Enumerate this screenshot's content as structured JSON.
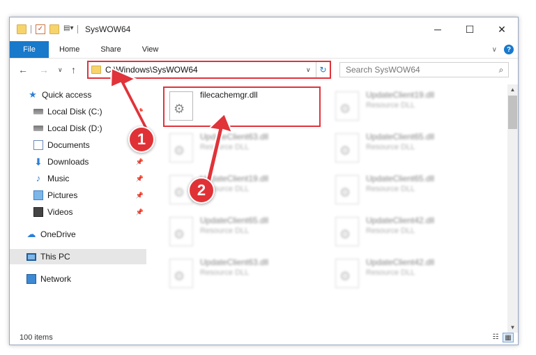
{
  "window": {
    "title": "SysWOW64",
    "minimize": "─",
    "maximize": "☐",
    "close": "✕"
  },
  "ribbon": {
    "file": "File",
    "tabs": [
      "Home",
      "Share",
      "View"
    ],
    "expand": "∨",
    "help": "?"
  },
  "address": {
    "path": "C:\\Windows\\SysWOW64",
    "dropdown": "∨",
    "refresh": "↻"
  },
  "search": {
    "placeholder": "Search SysWOW64",
    "icon": "⌕"
  },
  "nav_buttons": {
    "back": "←",
    "forward": "→",
    "recent": "∨",
    "up": "↑"
  },
  "sidebar": {
    "items": [
      {
        "label": "Quick access",
        "icon": "star-icon"
      },
      {
        "label": "Local Disk (C:)",
        "icon": "disk-icon",
        "pinned": true
      },
      {
        "label": "Local Disk (D:)",
        "icon": "disk-icon"
      },
      {
        "label": "Documents",
        "icon": "documents-icon",
        "pinned": true
      },
      {
        "label": "Downloads",
        "icon": "download-icon",
        "pinned": true
      },
      {
        "label": "Music",
        "icon": "music-icon",
        "pinned": true
      },
      {
        "label": "Pictures",
        "icon": "pictures-icon",
        "pinned": true
      },
      {
        "label": "Videos",
        "icon": "videos-icon",
        "pinned": true
      },
      {
        "label": "OneDrive",
        "icon": "cloud-icon"
      },
      {
        "label": "This PC",
        "icon": "computer-icon",
        "selected": true
      },
      {
        "label": "Network",
        "icon": "network-icon"
      }
    ]
  },
  "files": [
    {
      "name": "filecachemgr.dll",
      "type": ""
    },
    {
      "name": "UpdateClient19.dll",
      "type": "Resource DLL"
    },
    {
      "name": "UpdateClient63.dll",
      "type": "Resource DLL"
    },
    {
      "name": "UpdateClient65.dll",
      "type": "Resource DLL"
    },
    {
      "name": "UpdateClient19.dll",
      "type": "Resource DLL"
    },
    {
      "name": "UpdateClient65.dll",
      "type": "Resource DLL"
    },
    {
      "name": "UpdateClient65.dll",
      "type": "Resource DLL"
    },
    {
      "name": "UpdateClient42.dll",
      "type": "Resource DLL"
    },
    {
      "name": "UpdateClient63.dll",
      "type": "Resource DLL"
    },
    {
      "name": "UpdateClient42.dll",
      "type": "Resource DLL"
    }
  ],
  "status": {
    "items": "100 items"
  },
  "annotations": {
    "step1": "1",
    "step2": "2"
  },
  "colors": {
    "accent": "#1979ca",
    "annotation_red": "#e0333a"
  }
}
